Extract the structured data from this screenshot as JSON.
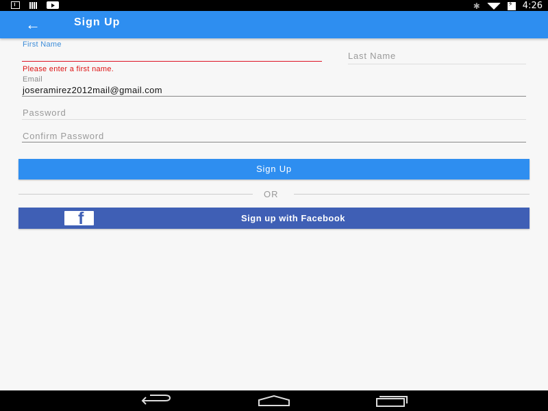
{
  "status_bar": {
    "time": "4:26",
    "icons": [
      "download-icon",
      "signal-bars-icon",
      "play-icon",
      "bluetooth-icon",
      "wifi-icon",
      "battery-charging-icon"
    ]
  },
  "app_bar": {
    "title": "Sign Up",
    "back_icon": "arrow-left-icon",
    "color": "#2e8ef0"
  },
  "form": {
    "first_name": {
      "label": "First Name",
      "value": "",
      "error": "Please enter a first name."
    },
    "last_name": {
      "placeholder": "Last Name",
      "value": ""
    },
    "email": {
      "label": "Email",
      "value": "joseramirez2012mail@gmail.com"
    },
    "password": {
      "placeholder": "Password",
      "value": ""
    },
    "confirm_password": {
      "placeholder": "Confirm Password",
      "value": ""
    }
  },
  "actions": {
    "signup_label": "Sign Up",
    "or_text": "OR",
    "facebook_label": "Sign up with Facebook",
    "facebook_color": "#3f5fb5"
  },
  "nav_bar": {
    "icons": [
      "nav-back-icon",
      "nav-home-icon",
      "nav-recents-icon"
    ]
  }
}
